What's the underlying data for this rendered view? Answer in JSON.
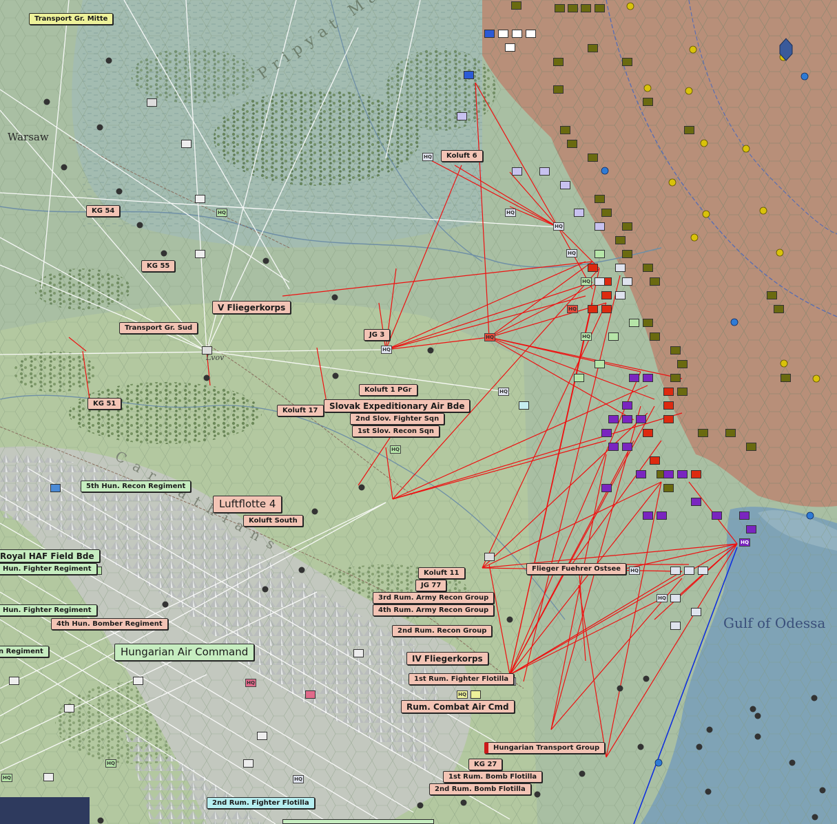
{
  "map": {
    "places": [
      {
        "id": "warsaw",
        "text": "Warsaw"
      },
      {
        "id": "lvov",
        "text": "Lvov"
      },
      {
        "id": "pripyat",
        "text": "Pripyat Marshes"
      },
      {
        "id": "gulf",
        "text": "Gulf of Odessa"
      },
      {
        "id": "carpathians",
        "text": "Carpathians"
      }
    ],
    "labels": [
      {
        "text": "Transport Gr. Mitte",
        "style": "yellow"
      },
      {
        "text": "Koluft 6",
        "style": "pink"
      },
      {
        "text": "KG 54",
        "style": "pink"
      },
      {
        "text": "KG 55",
        "style": "pink"
      },
      {
        "text": "V Fliegerkorps",
        "style": "pink"
      },
      {
        "text": "Transport Gr. Sud",
        "style": "pink"
      },
      {
        "text": "JG 3",
        "style": "pink"
      },
      {
        "text": "KG 51",
        "style": "pink"
      },
      {
        "text": "Koluft 1 PGr",
        "style": "pink"
      },
      {
        "text": "Koluft 17",
        "style": "pink"
      },
      {
        "text": "Slovak Expeditionary Air Bde",
        "style": "pink"
      },
      {
        "text": "2nd Slov. Fighter Sqn",
        "style": "pink"
      },
      {
        "text": "1st Slov. Recon Sqn",
        "style": "pink"
      },
      {
        "text": "5th Hun. Recon Regiment",
        "style": "green"
      },
      {
        "text": "Luftflotte 4",
        "style": "pink"
      },
      {
        "text": "Koluft South",
        "style": "pink"
      },
      {
        "text": "Royal HAF Field Bde",
        "style": "green"
      },
      {
        "text": "Hun. Fighter Regiment",
        "style": "green"
      },
      {
        "text": "Koluft 11",
        "style": "pink"
      },
      {
        "text": "Flieger Fuehrer Ostsee",
        "style": "pink"
      },
      {
        "text": "JG 77",
        "style": "pink"
      },
      {
        "text": "3rd Rum. Army Recon Group",
        "style": "pink"
      },
      {
        "text": "4th Rum. Army Recon Group",
        "style": "pink"
      },
      {
        "text": "Hun. Fighter Regiment",
        "style": "green"
      },
      {
        "text": "4th Hun. Bomber Regiment",
        "style": "pink"
      },
      {
        "text": "2nd Rum. Recon Group",
        "style": "pink"
      },
      {
        "text": "Hungarian Air Command",
        "style": "green"
      },
      {
        "text": "n Regiment",
        "style": "green"
      },
      {
        "text": "IV Fliegerkorps",
        "style": "pink"
      },
      {
        "text": "1st Rum. Fighter Flotilla",
        "style": "pink"
      },
      {
        "text": "Rum. Combat Air Cmd",
        "style": "pink"
      },
      {
        "text": "Hungarian Transport Group",
        "style": "pink"
      },
      {
        "text": "KG 27",
        "style": "pink"
      },
      {
        "text": "1st Rum. Bomb Flotilla",
        "style": "pink"
      },
      {
        "text": "2nd Rum. Bomb Flotilla",
        "style": "pink"
      },
      {
        "text": "2nd Rum. Fighter Flotilla",
        "style": "cyan"
      }
    ],
    "colors": {
      "axis_terrain": "#a9bfa3",
      "soviet_territory": "#b88f79",
      "sea": "#7fa3b6",
      "mission_lines": "#ee1111",
      "air_transfer_lines": "#ffffff",
      "sea_route": "#1030dd",
      "hq_counter": "#dfe3ee",
      "soviet_counter": "#6a6a10",
      "hungarian_counter": "#7a25c0",
      "soviet_armor": "#dd2a10"
    },
    "hq_text": "HQ"
  }
}
